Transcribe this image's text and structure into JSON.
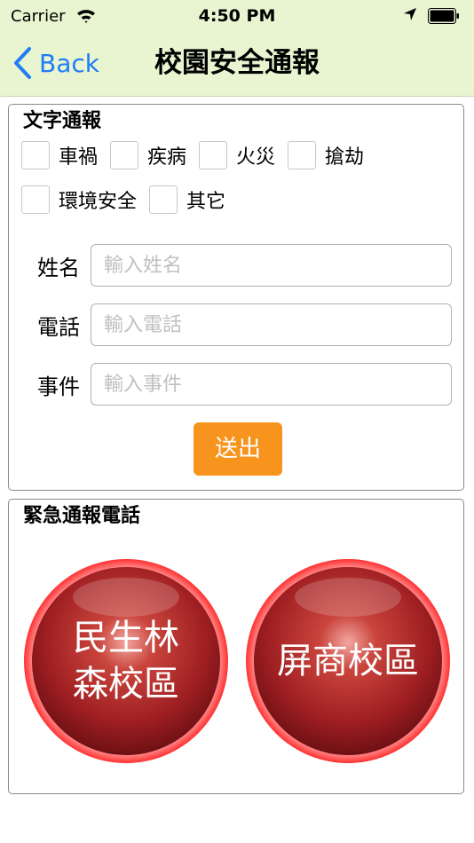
{
  "status_bar": {
    "carrier": "Carrier",
    "time": "4:50 PM"
  },
  "nav": {
    "back_label": "Back",
    "title": "校園安全通報"
  },
  "text_report": {
    "heading": "文字通報",
    "categories": [
      "車禍",
      "疾病",
      "火災",
      "搶劫",
      "環境安全",
      "其它"
    ],
    "fields": [
      {
        "label": "姓名",
        "placeholder": "輸入姓名"
      },
      {
        "label": "電話",
        "placeholder": "輸入電話"
      },
      {
        "label": "事件",
        "placeholder": "輸入事件"
      }
    ],
    "submit_label": "送出"
  },
  "emergency": {
    "heading": "緊急通報電話",
    "buttons": [
      {
        "line1": "民生林",
        "line2": "森校區"
      },
      {
        "line1": "屏商校區",
        "line2": ""
      }
    ]
  },
  "colors": {
    "accent": "#1f7cf5",
    "submit": "#f7941e",
    "nav_bg": "#e8f5d0",
    "call_red": "#b51f24"
  }
}
